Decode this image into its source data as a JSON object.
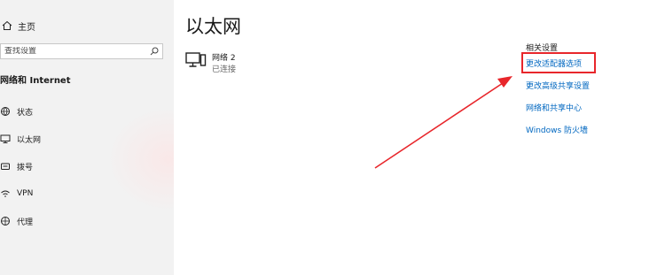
{
  "sidebar": {
    "home_label": "主页",
    "search_placeholder": "查找设置",
    "section_title": "网络和 Internet",
    "items": [
      {
        "label": "状态",
        "icon": "status-globe-icon"
      },
      {
        "label": "以太网",
        "icon": "ethernet-monitor-icon"
      },
      {
        "label": "拨号",
        "icon": "dialup-phone-icon"
      },
      {
        "label": "VPN",
        "icon": "vpn-icon"
      },
      {
        "label": "代理",
        "icon": "proxy-globe-icon"
      }
    ]
  },
  "main": {
    "title": "以太网",
    "adapter": {
      "name": "网络 2",
      "status": "已连接",
      "icon": "network-computer-icon"
    }
  },
  "related": {
    "title": "相关设置",
    "links": [
      "更改适配器选项",
      "更改高级共享设置",
      "网络和共享中心",
      "Windows 防火墙"
    ]
  },
  "annotation": {
    "highlight_color": "#e8262b",
    "arrow_color": "#e8262b"
  },
  "colors": {
    "link": "#0067c0",
    "sidebar_bg": "#f2f2f2"
  }
}
